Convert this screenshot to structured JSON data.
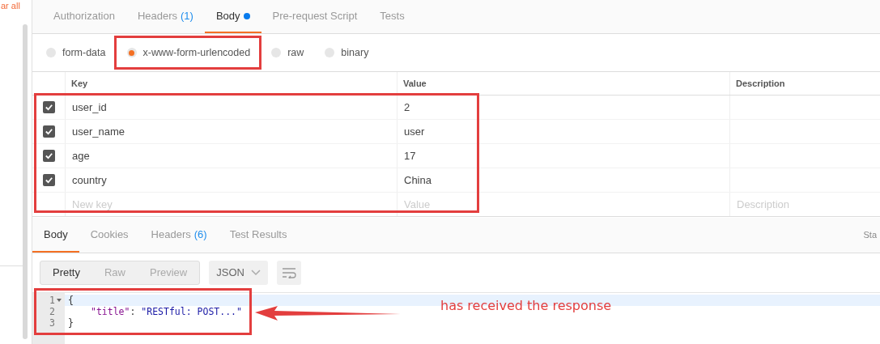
{
  "sidebar": {
    "link_text": "ar all"
  },
  "request_tabs": [
    {
      "label": "Authorization",
      "selected": false
    },
    {
      "label": "Headers",
      "count": "(1)",
      "selected": false
    },
    {
      "label": "Body",
      "dot": true,
      "selected": true
    },
    {
      "label": "Pre-request Script",
      "selected": false
    },
    {
      "label": "Tests",
      "selected": false
    }
  ],
  "body_modes": [
    {
      "label": "form-data",
      "selected": false
    },
    {
      "label": "x-www-form-urlencoded",
      "selected": true
    },
    {
      "label": "raw",
      "selected": false
    },
    {
      "label": "binary",
      "selected": false
    }
  ],
  "params_table": {
    "columns": [
      "Key",
      "Value",
      "Description"
    ],
    "rows": [
      {
        "checked": true,
        "key": "user_id",
        "value": "2"
      },
      {
        "checked": true,
        "key": "user_name",
        "value": "user"
      },
      {
        "checked": true,
        "key": "age",
        "value": "17"
      },
      {
        "checked": true,
        "key": "country",
        "value": "China"
      }
    ],
    "new_row": {
      "key_placeholder": "New key",
      "value_placeholder": "Value",
      "description_placeholder": "Description"
    }
  },
  "response_tabs": [
    {
      "label": "Body",
      "selected": true
    },
    {
      "label": "Cookies",
      "selected": false
    },
    {
      "label": "Headers",
      "count": "(6)",
      "selected": false
    },
    {
      "label": "Test Results",
      "selected": false
    }
  ],
  "status_label": "Sta",
  "view_modes": [
    {
      "label": "Pretty",
      "selected": true
    },
    {
      "label": "Raw",
      "selected": false
    },
    {
      "label": "Preview",
      "selected": false
    }
  ],
  "format": "JSON",
  "code_lines": [
    {
      "number": "1",
      "foldable": true,
      "indented": false,
      "tokens": [
        {
          "kind": "punct",
          "text": "{"
        }
      ]
    },
    {
      "number": "2",
      "foldable": false,
      "indented": true,
      "tokens": [
        {
          "kind": "key",
          "text": "\"title\""
        },
        {
          "kind": "punct",
          "text": ": "
        },
        {
          "kind": "string",
          "text": "\"RESTful: POST...\""
        }
      ]
    },
    {
      "number": "3",
      "foldable": false,
      "indented": false,
      "tokens": [
        {
          "kind": "punct",
          "text": "}"
        }
      ]
    }
  ],
  "annotation": {
    "text": "has received the response"
  }
}
